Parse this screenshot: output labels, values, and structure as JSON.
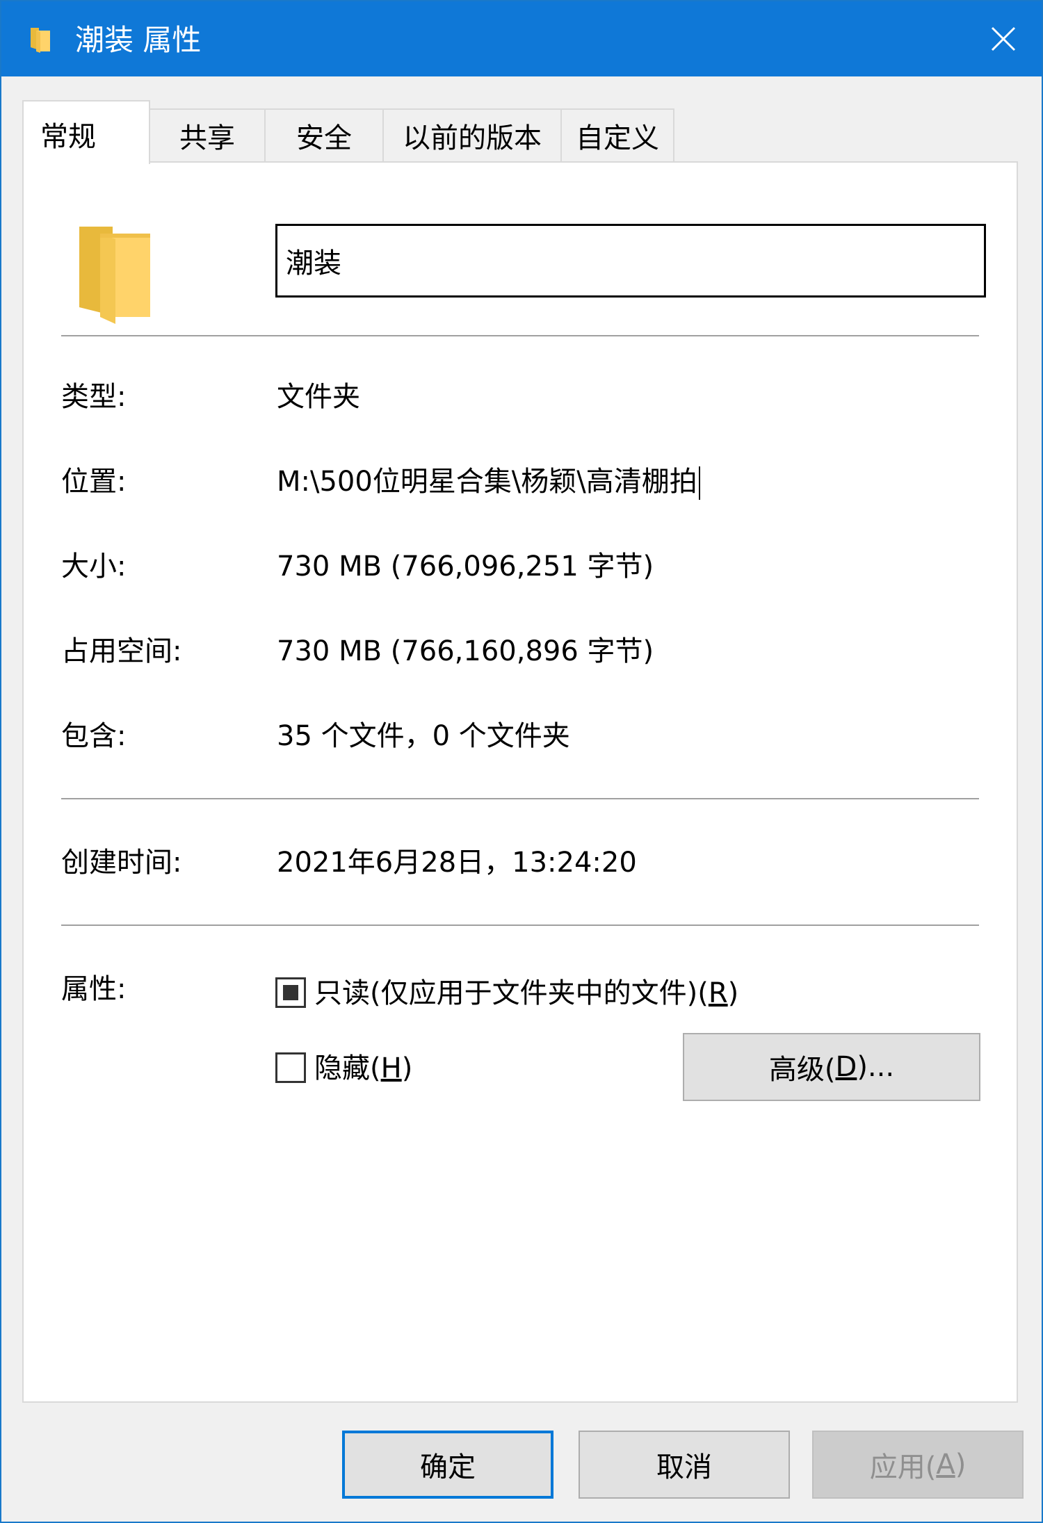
{
  "window": {
    "title": "潮装 属性",
    "accent_color": "#0f78d7",
    "title_icon": "folder-icon",
    "close_icon": "close-icon"
  },
  "tabs": [
    {
      "label": "常规",
      "active": true
    },
    {
      "label": "共享",
      "active": false
    },
    {
      "label": "安全",
      "active": false
    },
    {
      "label": "以前的版本",
      "active": false
    },
    {
      "label": "自定义",
      "active": false
    }
  ],
  "general": {
    "folder_icon": "folder-icon",
    "name_value": "潮装",
    "rows": {
      "type": {
        "label": "类型:",
        "value": "文件夹"
      },
      "location": {
        "label": "位置:",
        "value": "M:\\500位明星合集\\杨颖\\高清棚拍"
      },
      "size": {
        "label": "大小:",
        "value": "730 MB (766,096,251 字节)"
      },
      "size_on_disk": {
        "label": "占用空间:",
        "value": "730 MB (766,160,896 字节)"
      },
      "contains": {
        "label": "包含:",
        "value": "35 个文件，0 个文件夹"
      },
      "created": {
        "label": "创建时间:",
        "value": "2021年6月28日，13:24:20"
      }
    },
    "attributes": {
      "label": "属性:",
      "readonly": {
        "label": "只读(仅应用于文件夹中的文件)(",
        "key": "R",
        "suffix": ")",
        "state": "indeterminate"
      },
      "hidden": {
        "label": "隐藏(",
        "key": "H",
        "suffix": ")",
        "state": "unchecked"
      },
      "advanced": {
        "label": "高级(",
        "key": "D",
        "suffix": ")..."
      }
    }
  },
  "footer": {
    "ok": "确定",
    "cancel": "取消",
    "apply": {
      "label": "应用(",
      "key": "A",
      "suffix": ")"
    }
  }
}
